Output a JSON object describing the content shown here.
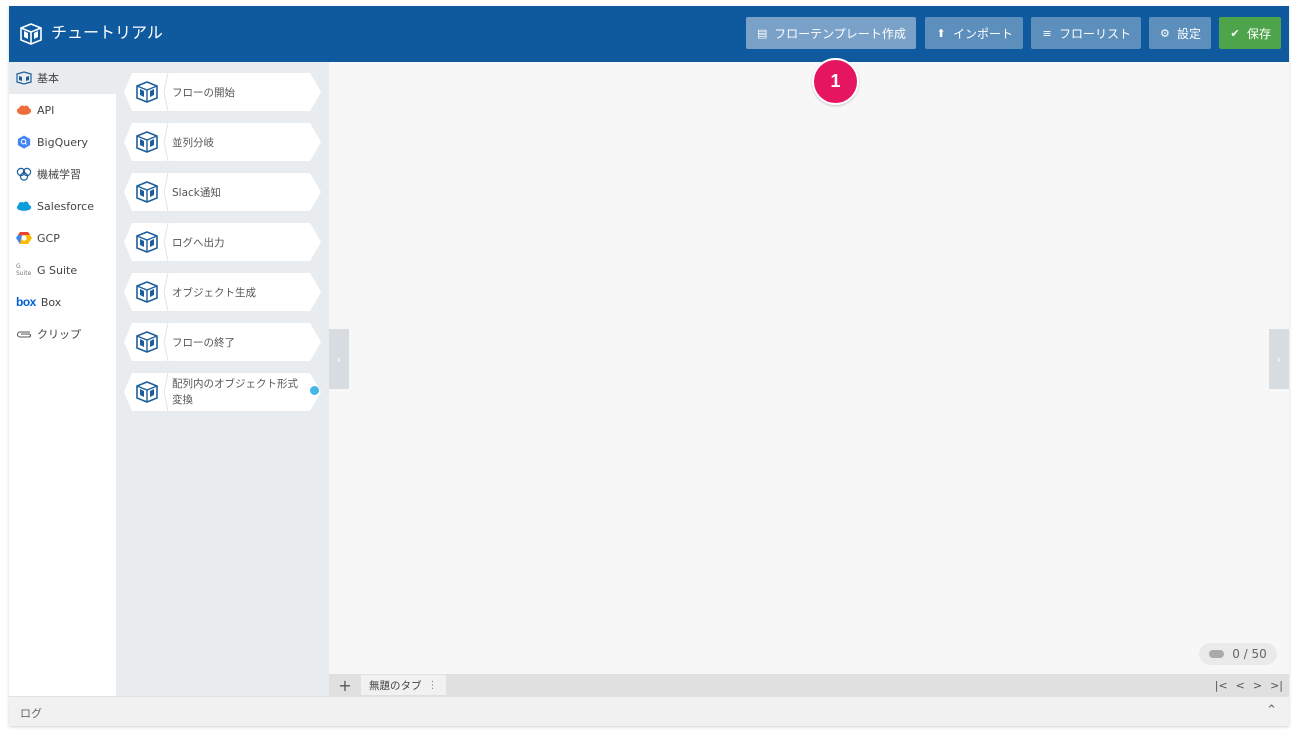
{
  "header": {
    "title": "チュートリアル",
    "buttons": {
      "template": "フローテンプレート作成",
      "import": "インポート",
      "flowlist": "フローリスト",
      "settings": "設定",
      "save": "保存"
    },
    "icons": {
      "template": "template-icon",
      "import": "upload-icon",
      "flowlist": "list-icon",
      "settings": "gear-icon",
      "save": "check-circle-icon"
    },
    "colors": {
      "header_bg": "#0f5a9e",
      "button_bg": "#5c8fbc",
      "save_bg": "#4ea44a"
    }
  },
  "step_badge": "1",
  "categories": [
    {
      "label": "基本",
      "icon": "blueprint-icon",
      "active": true
    },
    {
      "label": "API",
      "icon": "api-cloud-icon"
    },
    {
      "label": "BigQuery",
      "icon": "bigquery-icon"
    },
    {
      "label": "機械学習",
      "icon": "brain-icon"
    },
    {
      "label": "Salesforce",
      "icon": "salesforce-cloud-icon"
    },
    {
      "label": "GCP",
      "icon": "gcp-icon"
    },
    {
      "label": "G Suite",
      "icon": "gsuite-icon",
      "icon_text": "G Suite"
    },
    {
      "label": "Box",
      "icon": "box-icon",
      "icon_text": "box"
    },
    {
      "label": "クリップ",
      "icon": "paperclip-icon"
    }
  ],
  "blocks": [
    {
      "label": "フローの開始"
    },
    {
      "label": "並列分岐"
    },
    {
      "label": "Slack通知"
    },
    {
      "label": "ログへ出力"
    },
    {
      "label": "オブジェクト生成"
    },
    {
      "label": "フローの終了"
    },
    {
      "label": "配列内のオブジェクト形式変換",
      "has_dot": true
    }
  ],
  "canvas": {
    "counter": "0 / 50"
  },
  "tabs": {
    "add": "+",
    "items": [
      {
        "label": "無題のタブ",
        "menu": "⋮"
      }
    ],
    "nav": [
      "|<",
      "<",
      ">",
      ">|"
    ]
  },
  "log": {
    "label": "ログ",
    "toggle": "⌃"
  }
}
